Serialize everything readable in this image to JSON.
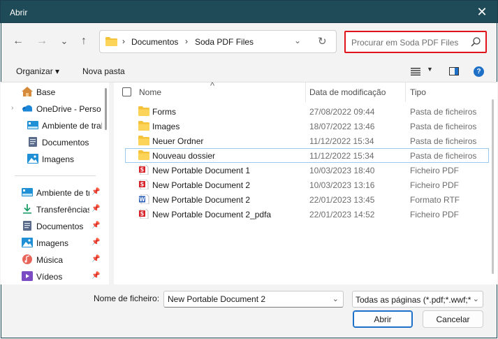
{
  "window": {
    "title": "Abrir",
    "close_glyph": "✕"
  },
  "nav": {
    "back_glyph": "←",
    "forward_glyph": "→",
    "recent_glyph": "⌄",
    "up_glyph": "↑"
  },
  "address": {
    "crumbs": [
      "Documentos",
      "Soda PDF Files"
    ],
    "separator": "›",
    "dropdown_glyph": "⌄",
    "refresh_glyph": "↻"
  },
  "search": {
    "placeholder": "Procurar em Soda PDF Files",
    "highlight_color": "#e0131a"
  },
  "toolbar": {
    "organize_label": "Organizar ▾",
    "new_folder_label": "Nova pasta",
    "help_label": "?",
    "view_dd": "▼"
  },
  "sidebar": {
    "items": [
      {
        "label": "Base",
        "icon": "home-icon",
        "pin": ""
      },
      {
        "label": "OneDrive - Personal",
        "icon": "cloud-icon",
        "pin": "",
        "chev": "›"
      },
      {
        "label": "Ambiente de trabalho",
        "icon": "desktop-icon",
        "pin": ""
      },
      {
        "label": "Documentos",
        "icon": "documents-icon",
        "pin": ""
      },
      {
        "label": "Imagens",
        "icon": "pictures-icon",
        "pin": ""
      },
      {
        "label": "Ambiente de trabalho",
        "icon": "desktop-icon",
        "pin": "📌"
      },
      {
        "label": "Transferências",
        "icon": "download-icon",
        "pin": "📌"
      },
      {
        "label": "Documentos",
        "icon": "documents-icon",
        "pin": "📌"
      },
      {
        "label": "Imagens",
        "icon": "pictures-icon",
        "pin": "📌"
      },
      {
        "label": "Música",
        "icon": "music-icon",
        "pin": "📌"
      },
      {
        "label": "Vídeos",
        "icon": "videos-icon",
        "pin": "📌"
      }
    ]
  },
  "columns": {
    "name": "Nome",
    "date": "Data de modificação",
    "type": "Tipo",
    "sort_glyph": "^"
  },
  "files": [
    {
      "name": "Forms",
      "date": "27/08/2022 09:44",
      "type": "Pasta de ficheiros",
      "icon": "folder-icon"
    },
    {
      "name": "Images",
      "date": "18/07/2022 13:46",
      "type": "Pasta de ficheiros",
      "icon": "folder-icon"
    },
    {
      "name": "Neuer Ordner",
      "date": "11/12/2022 15:34",
      "type": "Pasta de ficheiros",
      "icon": "folder-icon"
    },
    {
      "name": "Nouveau dossier",
      "date": "11/12/2022 15:34",
      "type": "Pasta de ficheiros",
      "icon": "folder-icon"
    },
    {
      "name": "New Portable Document 1",
      "date": "10/03/2023 18:40",
      "type": "Ficheiro PDF",
      "icon": "pdf-icon"
    },
    {
      "name": "New Portable Document 2",
      "date": "10/03/2023 13:16",
      "type": "Ficheiro PDF",
      "icon": "pdf-icon"
    },
    {
      "name": "New Portable Document 2",
      "date": "22/01/2023 13:45",
      "type": "Formato RTF",
      "icon": "word-icon"
    },
    {
      "name": "New Portable Document 2_pdfa",
      "date": "22/01/2023 14:52",
      "type": "Ficheiro PDF",
      "icon": "pdf-icon"
    }
  ],
  "footer": {
    "filename_label": "Nome de ficheiro:",
    "filename_value": "New Portable Document 2",
    "filter_value": "Todas as páginas (*.pdf;*.wwf;*.",
    "dd_glyph": "⌄",
    "open_label": "Abrir",
    "cancel_label": "Cancelar"
  }
}
